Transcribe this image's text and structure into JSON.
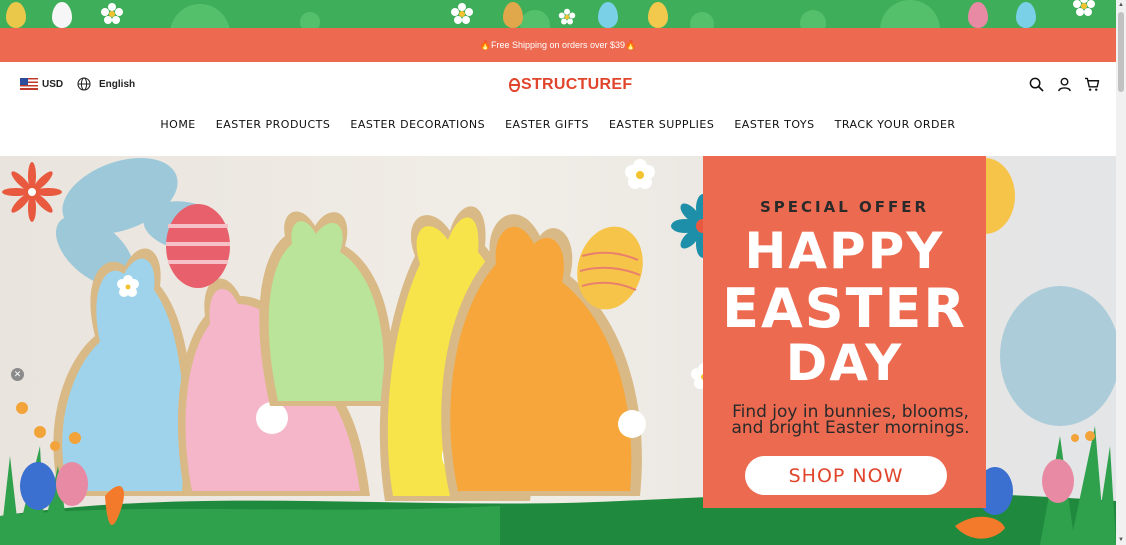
{
  "announcement": {
    "text": "🔥Free Shipping on orders over $39🔥"
  },
  "header": {
    "currency": "USD",
    "language": "English",
    "logo_text": "STRUCTUREF",
    "icons": [
      "search-icon",
      "account-icon",
      "cart-icon"
    ]
  },
  "nav": {
    "items": [
      {
        "label": "HOME"
      },
      {
        "label": "EASTER PRODUCTS"
      },
      {
        "label": "EASTER DECORATIONS"
      },
      {
        "label": "EASTER GIFTS"
      },
      {
        "label": "EASTER SUPPLIES"
      },
      {
        "label": "EASTER TOYS"
      },
      {
        "label": "TRACK YOUR ORDER"
      }
    ]
  },
  "hero": {
    "offer_label": "SPECIAL OFFER",
    "headline_1": "HAPPY",
    "headline_2": "EASTER",
    "headline_3": "DAY",
    "tagline_1": "Find joy in bunnies, blooms,",
    "tagline_2": "and bright Easter mornings.",
    "cta": "SHOP NOW"
  },
  "colors": {
    "brand": "#e0452c",
    "announcement_bg": "#ed6a50",
    "promo_bg": "#ec6a50",
    "deco_green": "#3fae5a"
  }
}
